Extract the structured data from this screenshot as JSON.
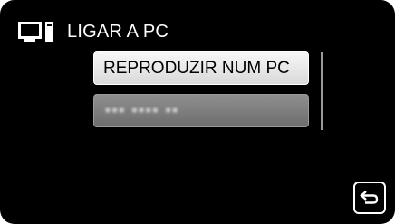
{
  "header": {
    "icon": "pc-connection-icon",
    "title": "LIGAR A PC"
  },
  "menu": {
    "items": [
      {
        "label": "REPRODUZIR NUM PC",
        "state": "highlighted"
      },
      {
        "label": "▪▪▪ ▪▪▪▪ ▪▪",
        "state": "blurred"
      }
    ]
  },
  "controls": {
    "back_icon": "return-arrow-icon"
  }
}
